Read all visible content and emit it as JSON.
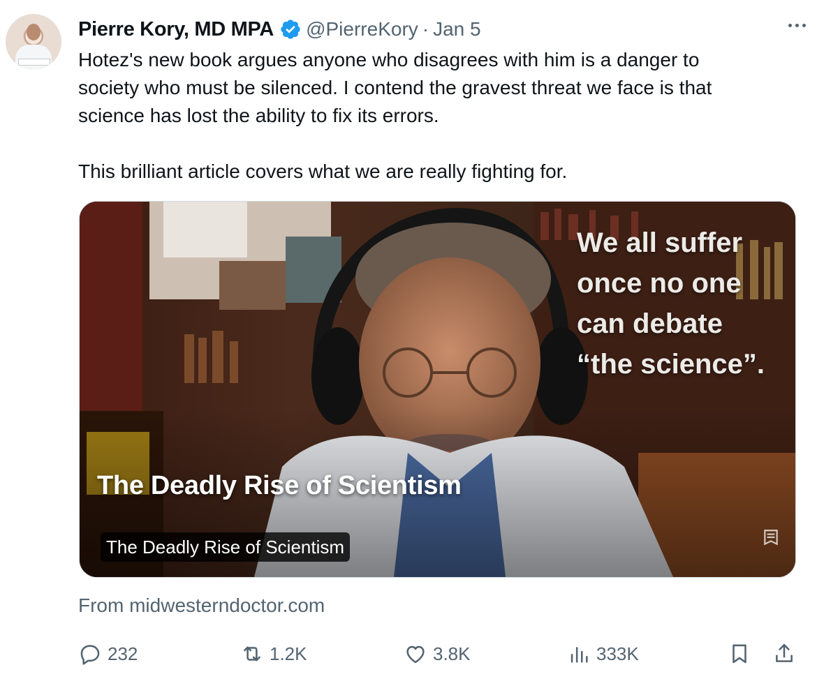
{
  "author": {
    "name": "Pierre Kory, MD MPA",
    "handle": "@PierreKory",
    "separator": "·",
    "date": "Jan 5",
    "avatar_icon": "user-avatar",
    "verified_color": "#1d9bf0"
  },
  "tweet": {
    "text": "Hotez's new book argues anyone who disagrees with him is a danger to\nsociety who must be silenced. I contend the gravest threat we face is that\nscience has lost the ability to fix its errors.\n\nThis brilliant article covers what we are really fighting for."
  },
  "card": {
    "quote_overlay": "We all suffer\nonce no one\ncan debate\n“the science”.",
    "title_overlay": "The Deadly Rise of Scientism",
    "label": "The Deadly Rise of Scientism",
    "source": "From midwesterndoctor.com"
  },
  "actions": {
    "replies": "232",
    "reposts": "1.2K",
    "likes": "3.8K",
    "views": "333K"
  },
  "colors": {
    "secondary_text": "#536471",
    "primary_text": "#0f1419"
  }
}
